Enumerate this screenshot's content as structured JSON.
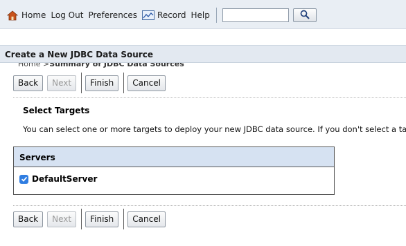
{
  "topnav": {
    "home": "Home",
    "logout": "Log Out",
    "preferences": "Preferences",
    "record": "Record",
    "help": "Help",
    "search_value": ""
  },
  "breadcrumb": {
    "home": "Home >",
    "current": "Summary of JDBC Data Sources"
  },
  "panel": {
    "title": "Create a New JDBC Data Source"
  },
  "buttons": {
    "back": "Back",
    "next": "Next",
    "finish": "Finish",
    "cancel": "Cancel"
  },
  "targets": {
    "title": "Select Targets",
    "description": "You can select one or more targets to deploy your new JDBC data source. If you don't select a targ"
  },
  "servers": {
    "header": "Servers",
    "items": [
      {
        "name": "DefaultServer",
        "checked": true
      }
    ]
  },
  "colors": {
    "topbar": "#e9eef4",
    "panel_header": "#e3e9f1",
    "table_header": "#d6e2f2",
    "checkbox": "#2f7de1"
  }
}
